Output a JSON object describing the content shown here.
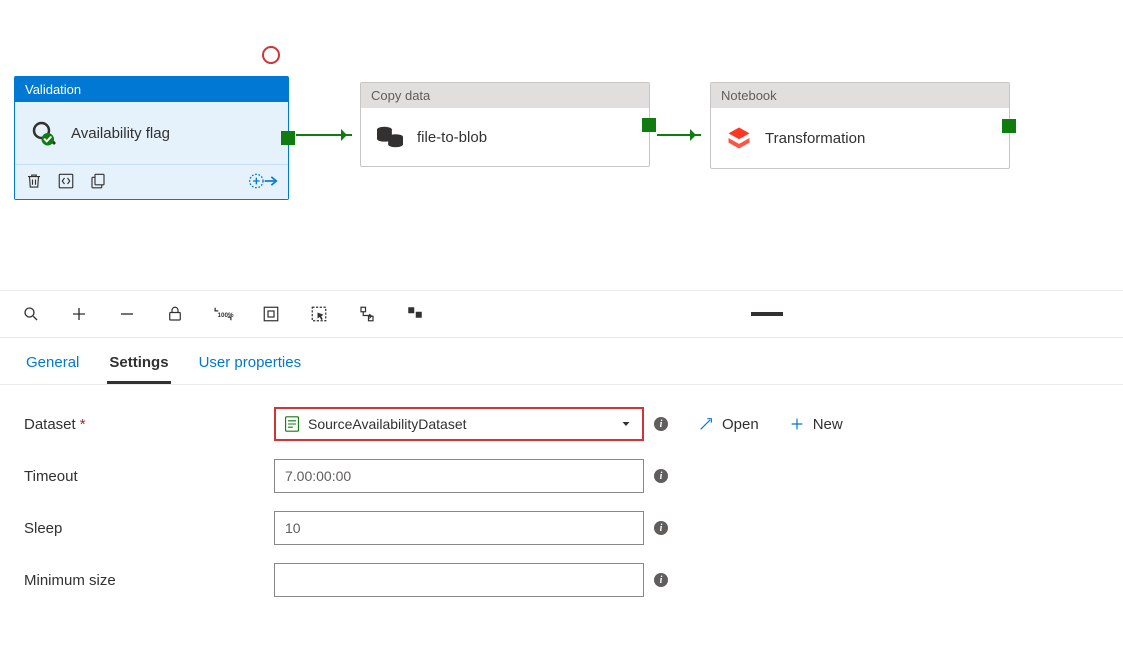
{
  "activities": {
    "validation": {
      "header": "Validation",
      "name": "Availability flag"
    },
    "copy": {
      "header": "Copy data",
      "name": "file-to-blob"
    },
    "notebook": {
      "header": "Notebook",
      "name": "Transformation"
    }
  },
  "tabs": {
    "general": "General",
    "settings": "Settings",
    "userProps": "User properties"
  },
  "settings": {
    "datasetLabel": "Dataset",
    "datasetValue": "SourceAvailabilityDataset",
    "timeoutLabel": "Timeout",
    "timeoutValue": "7.00:00:00",
    "sleepLabel": "Sleep",
    "sleepValue": "10",
    "minSizeLabel": "Minimum size",
    "minSizeValue": ""
  },
  "actions": {
    "open": "Open",
    "new": "New"
  }
}
